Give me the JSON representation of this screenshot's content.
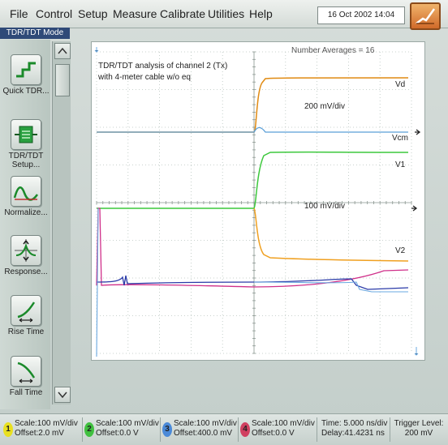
{
  "menu": {
    "items": [
      "File",
      "Control",
      "Setup",
      "Measure",
      "Calibrate",
      "Utilities",
      "Help"
    ],
    "datetime": "16 Oct 2002   14:04"
  },
  "mode_label": "TDR/TDT Mode",
  "toolbar": {
    "tools": [
      {
        "label": "Quick TDR...",
        "icon": "quick-tdr-icon"
      },
      {
        "label": "TDR/TDT Setup...",
        "icon": "tdr-setup-icon"
      },
      {
        "label": "Normalize...",
        "icon": "normalize-icon"
      },
      {
        "label": "Response...",
        "icon": "response-icon"
      },
      {
        "label": "Rise Time",
        "icon": "rise-time-icon"
      },
      {
        "label": "Fall Time",
        "icon": "fall-time-icon"
      }
    ]
  },
  "display": {
    "annotation_line1": "TDR/TDT analysis of channel 2 (Tx)",
    "annotation_line2": "with 4-meter cable w/o eq",
    "averages": "Number Averages = 16",
    "scale_upper": "200 mV/div",
    "scale_lower": "100 mV/div",
    "trace_labels": {
      "vd": "Vd",
      "vcm": "Vcm",
      "v1": "V1",
      "v2": "V2"
    },
    "colors": {
      "vd": "#e08a12",
      "vcm": "#5a9fd8",
      "v1": "#3cc83c",
      "v2": "#f0a020",
      "magenta": "#d0308a",
      "blue": "#2a3aa8",
      "grid": "#b8c4be",
      "center": "#8a9690"
    }
  },
  "status": {
    "channels": [
      {
        "num": "1",
        "scale": "Scale:100 mV/div",
        "offset": "Offset:2.0 mV",
        "color": "#e8e020"
      },
      {
        "num": "2",
        "scale": "Scale:100 mV/div",
        "offset": "Offset:0.0 V",
        "color": "#40c040"
      },
      {
        "num": "3",
        "scale": "Scale:100 mV/div",
        "offset": "Offset:400.0 mV",
        "color": "#4a8ad8"
      },
      {
        "num": "4",
        "scale": "Scale:100 mV/div",
        "offset": "Offset:0.0 V",
        "color": "#d04060"
      }
    ],
    "time": "Time: 5.000 ns/div",
    "delay": "Delay:41.4231 ns",
    "trigger_label": "Trigger Level:",
    "trigger_value": "200 mV"
  }
}
